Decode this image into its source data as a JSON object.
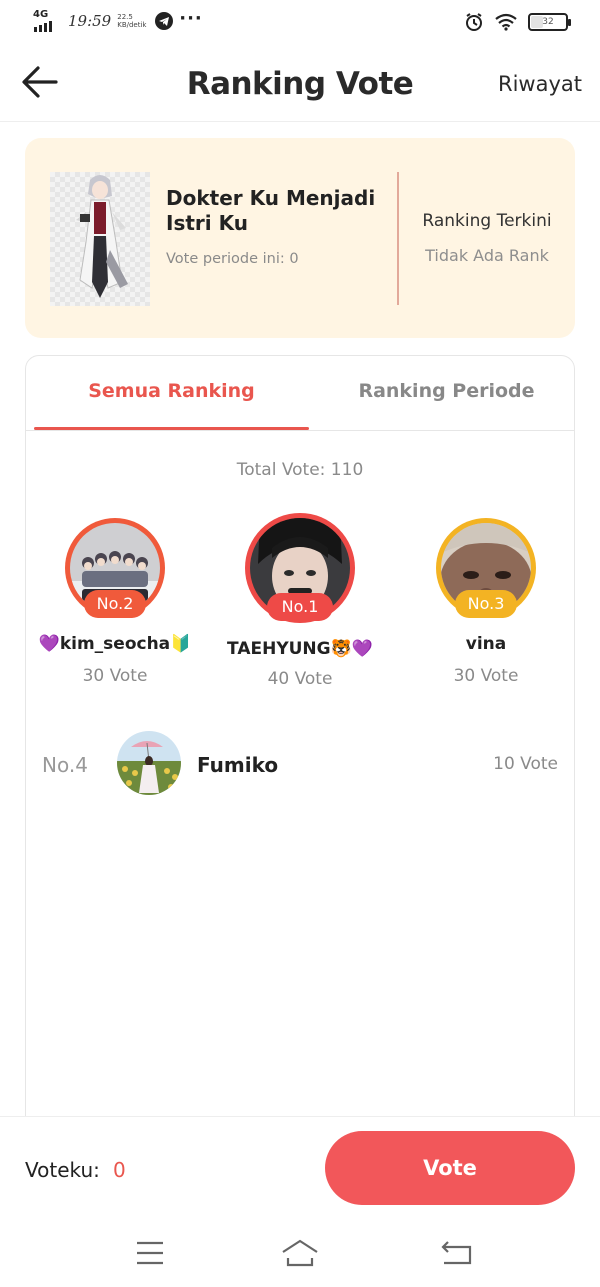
{
  "status_bar": {
    "network": "4G",
    "time": "19:59",
    "speed_value": "22.5",
    "speed_unit": "KB/detik",
    "battery": "32"
  },
  "header": {
    "title": "Ranking Vote",
    "history_label": "Riwayat"
  },
  "book": {
    "title": "Dokter Ku Menjadi Istri Ku",
    "vote_periode": "Vote periode ini: 0",
    "ranking_label": "Ranking Terkini",
    "ranking_value": "Tidak Ada Rank"
  },
  "tabs": [
    {
      "label": "Semua Ranking",
      "active": true
    },
    {
      "label": "Ranking Periode",
      "active": false
    }
  ],
  "total_vote": "Total Vote: 110",
  "podium": [
    {
      "rank": "No.1",
      "name": "TAEHYUNG🐯💜",
      "votes": "40 Vote",
      "color": "#ee4a47"
    },
    {
      "rank": "No.2",
      "name": "💜kim_seocha🔰",
      "votes": "30 Vote",
      "color": "#f05a3b"
    },
    {
      "rank": "No.3",
      "name": "vina",
      "votes": "30 Vote",
      "color": "#f3b323"
    }
  ],
  "list": [
    {
      "rank": "No.4",
      "name": "Fumiko",
      "votes": "10 Vote"
    }
  ],
  "footer": {
    "voteku_label": "Voteku:",
    "voteku_value": "0",
    "vote_button": "Vote"
  },
  "nav": {
    "icons": [
      "menu-icon",
      "home-icon",
      "back-nav-icon"
    ]
  },
  "colors": {
    "accent": "#e9564e",
    "vote_button": "#f2575a",
    "card_bg": "#fff5e3"
  }
}
